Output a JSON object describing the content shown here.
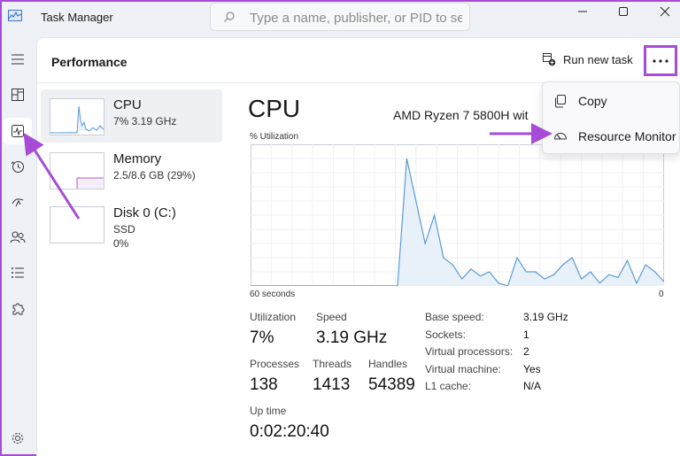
{
  "window": {
    "title": "Task Manager",
    "search_placeholder": "Type a name, publisher, or PID to se..."
  },
  "header": {
    "title": "Performance",
    "run_new_task": "Run new task"
  },
  "menu": {
    "items": [
      {
        "label": "Copy",
        "icon": "copy-icon"
      },
      {
        "label": "Resource Monitor",
        "icon": "resource-monitor-icon"
      }
    ]
  },
  "devices": [
    {
      "name": "CPU",
      "sub": "7% 3.19 GHz",
      "sub2": ""
    },
    {
      "name": "Memory",
      "sub": "2.5/8.6 GB (29%)",
      "sub2": ""
    },
    {
      "name": "Disk 0 (C:)",
      "sub": "SSD",
      "sub2": "0%"
    }
  ],
  "detail": {
    "title": "CPU",
    "model": "AMD Ryzen 7 5800H wit",
    "util_label": "% Utilization",
    "axis_left": "60 seconds",
    "axis_right": "0",
    "stats": {
      "utilization_label": "Utilization",
      "utilization": "7%",
      "speed_label": "Speed",
      "speed": "3.19 GHz",
      "processes_label": "Processes",
      "processes": "138",
      "threads_label": "Threads",
      "threads": "1413",
      "handles_label": "Handles",
      "handles": "54389",
      "uptime_label": "Up time",
      "uptime": "0:02:20:40"
    },
    "specs": [
      {
        "label": "Base speed:",
        "value": "3.19 GHz"
      },
      {
        "label": "Sockets:",
        "value": "1"
      },
      {
        "label": "Virtual processors:",
        "value": "2"
      },
      {
        "label": "Virtual machine:",
        "value": "Yes"
      },
      {
        "label": "L1 cache:",
        "value": "N/A"
      }
    ]
  },
  "chart_data": {
    "type": "area",
    "x": [
      60,
      58,
      56,
      54,
      52,
      50,
      48,
      46,
      44,
      42,
      40,
      38,
      36,
      34,
      32,
      30,
      28,
      26,
      24,
      22,
      20,
      18,
      16,
      14,
      12,
      10,
      8,
      6,
      4,
      2,
      0
    ],
    "values": [
      0,
      0,
      0,
      0,
      0,
      0,
      0,
      0,
      0,
      0,
      0,
      0,
      0,
      0,
      0,
      0,
      0,
      90,
      60,
      30,
      50,
      20,
      15,
      5,
      12,
      7,
      10,
      2,
      0,
      20,
      10,
      10,
      5,
      8,
      15,
      20,
      5,
      10,
      2,
      8,
      6,
      18,
      2,
      15,
      10,
      3
    ],
    "ylim": [
      0,
      100
    ],
    "grid": true
  },
  "colors": {
    "accent": "#a64cd6",
    "cpu_line": "#5b9bd5",
    "cpu_fill": "#e8f1fa",
    "memory_line": "#b05cc6"
  }
}
